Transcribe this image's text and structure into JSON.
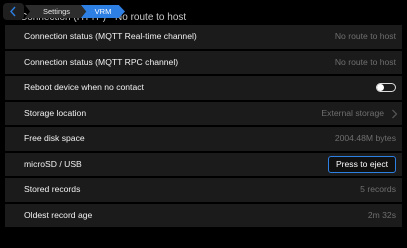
{
  "header": {
    "breadcrumb": [
      "Settings",
      "VRM"
    ]
  },
  "partial_row_text": "Connection (HTTP) - No route to host",
  "rows": [
    {
      "label": "Connection status (MQTT Real-time channel)",
      "value": "No route to host"
    },
    {
      "label": "Connection status (MQTT RPC channel)",
      "value": "No route to host"
    },
    {
      "label": "Reboot device when no contact",
      "toggle": false
    },
    {
      "label": "Storage location",
      "value": "External storage"
    },
    {
      "label": "Free disk space",
      "value": "2004.48M bytes"
    },
    {
      "label": "microSD / USB",
      "button": "Press to eject"
    },
    {
      "label": "Stored records",
      "value": "5 records"
    },
    {
      "label": "Oldest record age",
      "value": "2m 32s"
    }
  ],
  "colors": {
    "accent": "#2d7fe3",
    "row_bg": "#1b1b1b",
    "value_text": "#6f6f6f"
  }
}
